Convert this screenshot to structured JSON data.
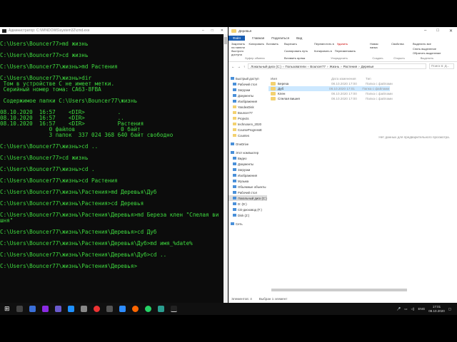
{
  "cmd": {
    "title": "Администратор: C:\\WINDOWS\\system32\\cmd.exe",
    "lines": [
      "C:\\Users\\Bouncer77>md жизнь",
      "",
      "C:\\Users\\Bouncer77>cd жизнь",
      "",
      "C:\\Users\\Bouncer77\\жизнь>md Растения",
      "",
      "C:\\Users\\Bouncer77\\жизнь>dir",
      " Том в устройстве C не имеет метки.",
      " Серийный номер тома: CA63-8FBA",
      "",
      " Содержимое папки C:\\Users\\Bouncer77\\жизнь",
      "",
      "08.10.2020  16:57    <DIR>          .",
      "08.10.2020  16:57    <DIR>          ..",
      "08.10.2020  16:57    <DIR>          Растения",
      "               0 файлов              0 байт",
      "               3 папок  337 024 368 640 байт свободно",
      "",
      "C:\\Users\\Bouncer77\\жизнь>cd ..",
      "",
      "C:\\Users\\Bouncer77>cd жизнь",
      "",
      "C:\\Users\\Bouncer77\\жизнь>cd .",
      "",
      "C:\\Users\\Bouncer77\\жизнь>cd Растения",
      "",
      "C:\\Users\\Bouncer77\\жизнь\\Растения>md Деревья\\Дуб",
      "",
      "C:\\Users\\Bouncer77\\жизнь\\Растения>cd Деревья",
      "",
      "C:\\Users\\Bouncer77\\жизнь\\Растения\\Деревья>md Береза клен \"Спелая ви",
      "шня\"",
      "",
      "C:\\Users\\Bouncer77\\жизнь\\Растения\\Деревья>cd Дуб",
      "",
      "C:\\Users\\Bouncer77\\жизнь\\Растения\\Деревья\\Дуб>md имя_%date%",
      "",
      "C:\\Users\\Bouncer77\\жизнь\\Растения\\Деревья\\Дуб>cd ..",
      "",
      "C:\\Users\\Bouncer77\\жизнь\\Растения\\Деревья>"
    ]
  },
  "explorer": {
    "title": "Деревья",
    "tabs": [
      "Файл",
      "Главная",
      "Поделиться",
      "Вид"
    ],
    "ribbon": {
      "pin": "Закрепить на панели быстрого доступа",
      "copy": "Копировать",
      "paste": "Вставить",
      "cut": "Вырезать",
      "copy_path": "Скопировать путь",
      "paste_shortcut": "Вставить ярлык",
      "clipboard": "Буфер обмена",
      "move_to": "Переместить в",
      "copy_to": "Копировать в",
      "delete": "Удалить",
      "rename": "Переименовать",
      "organize": "Упорядочить",
      "new_folder": "Новая папка",
      "create": "Создать",
      "properties": "Свойства",
      "open": "Открыть",
      "select_all": "Выделить все",
      "select_none": "Снять выделение",
      "invert": "Обратить выделение",
      "select": "Выделить"
    },
    "path": [
      "Локальный диск (C:)",
      "Пользователи",
      "Bouncer77",
      "Жизнь",
      "Растения",
      "Деревья"
    ],
    "search_placeholder": "Поиск в: Д...",
    "nav": [
      "Быстрый доступ",
      "Рабочий стол",
      "Загрузки",
      "Документы",
      "Изображения",
      "YandexDisk",
      "Bouncer77",
      "Projects",
      "technoserv_2020",
      "CourseProgressE",
      "Countes",
      "OneDrive",
      "Этот компьютер",
      "Видео",
      "Документы",
      "Загрузки",
      "Изображения",
      "Музыка",
      "Объемные объекты",
      "Рабочий стол",
      "Локальный диск (C:)",
      "D: (D:)",
      "CD-дисковод (F:)",
      "Disk (Z:)",
      "Сеть"
    ],
    "columns": [
      "Имя",
      "Дата изменения",
      "Тип"
    ],
    "files": [
      {
        "name": "Береза",
        "date": "08.10.2020 17:00",
        "type": "Папка с файлами"
      },
      {
        "name": "Дуб",
        "date": "08.10.2020 17:01",
        "type": "Папка с файлами"
      },
      {
        "name": "Клен",
        "date": "08.10.2020 17:00",
        "type": "Папка с файлами"
      },
      {
        "name": "Спелая вишня",
        "date": "08.10.2020 17:00",
        "type": "Папка с файлами"
      }
    ],
    "preview": "Нет данных для предварительного просмотра.",
    "status_items": "Элементов: 4",
    "status_selected": "Выбран 1 элемент"
  },
  "taskbar": {
    "lang": "ENG",
    "time": "17:01",
    "date": "08.10.2020"
  }
}
